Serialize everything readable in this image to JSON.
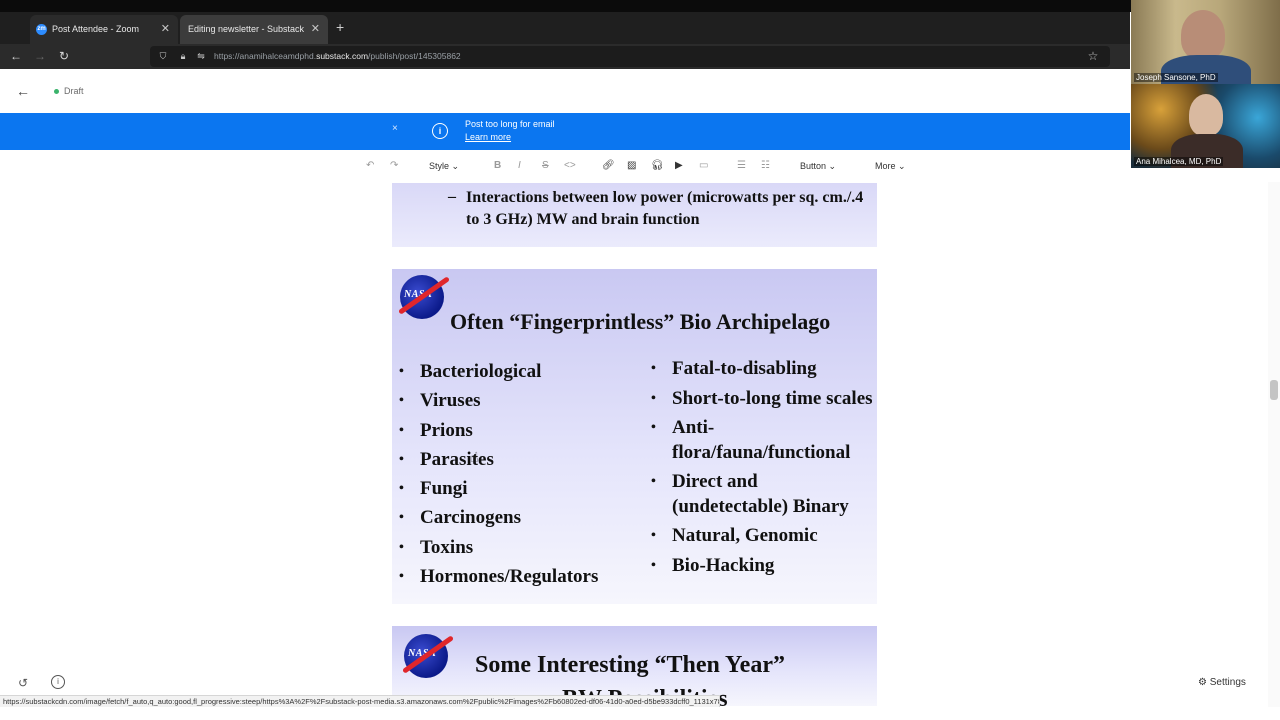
{
  "browser": {
    "tabs": [
      {
        "title": "Post Attendee - Zoom",
        "icon": "zoom-icon"
      },
      {
        "title": "Editing newsletter - Substack",
        "icon": "none"
      }
    ],
    "url_prefix": "https://anamihalceamdphd.",
    "url_domain": "substack.com",
    "url_path": "/publish/post/145305862"
  },
  "editor": {
    "status": "Draft",
    "notice": {
      "title": "Post too long for email",
      "link": "Learn more",
      "close": "×"
    },
    "toolbar": {
      "style": "Style",
      "button": "Button",
      "more": "More"
    },
    "settings": "Settings"
  },
  "slides": {
    "top": {
      "dash": "–",
      "text": "Interactions between low power (microwatts per sq. cm./.4 to 3 GHz) MW and brain function"
    },
    "slide2": {
      "title": "Often “Fingerprintless” Bio Archipelago",
      "left_items": [
        "Bacteriological",
        "Viruses",
        "Prions",
        "Parasites",
        "Fungi",
        "Carcinogens",
        "Toxins",
        "Hormones/Regulators"
      ],
      "right_items": [
        "Fatal-to-disabling",
        "Short-to-long time scales",
        "Anti-flora/fauna/functional",
        "Direct and (undetectable) Binary",
        "Natural, Genomic",
        "Bio-Hacking"
      ]
    },
    "slide3": {
      "title": "Some Interesting “Then Year”",
      "subtitle": "BW Possibilities"
    },
    "logo_text": "NASA"
  },
  "video": {
    "participants": [
      "Joseph Sansone, PhD",
      "Ana Mihalcea, MD, PhD"
    ]
  },
  "status_url": "https://substackcdn.com/image/fetch/f_auto,q_auto:good,fl_progressive:steep/https%3A%2F%2Fsubstack-post-media.s3.amazonaws.com%2Fpublic%2Fimages%2Fb60802ed-df06-41d0-a0ed-d5be933dcff0_1131x781.png"
}
